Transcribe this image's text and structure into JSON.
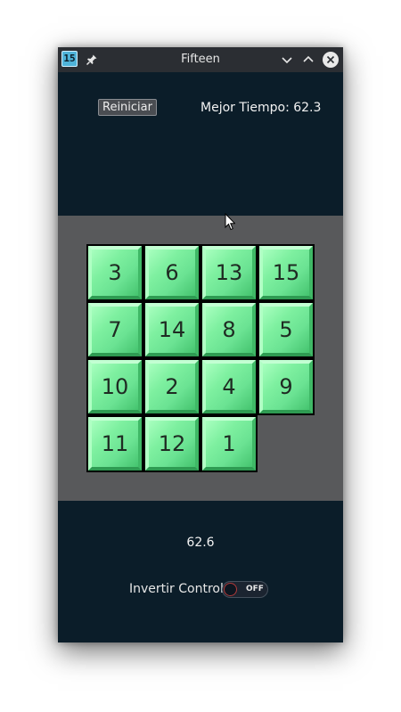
{
  "window": {
    "title": "Fifteen",
    "app_icon_text": "15"
  },
  "header": {
    "restart_label": "Reiniciar",
    "best_time_label": "Mejor Tiempo: 62.3"
  },
  "board": {
    "tiles": [
      "3",
      "6",
      "13",
      "15",
      "7",
      "14",
      "8",
      "5",
      "10",
      "2",
      "4",
      "9",
      "11",
      "12",
      "1",
      ""
    ]
  },
  "footer": {
    "current_time": "62.6",
    "invert_label": "Invertir Control",
    "toggle_state": "OFF"
  },
  "colors": {
    "window_bg": "#0b1d29",
    "board_bg": "#58595b",
    "tile": "#6be393",
    "toggle_knob_border": "#b03a3a"
  }
}
